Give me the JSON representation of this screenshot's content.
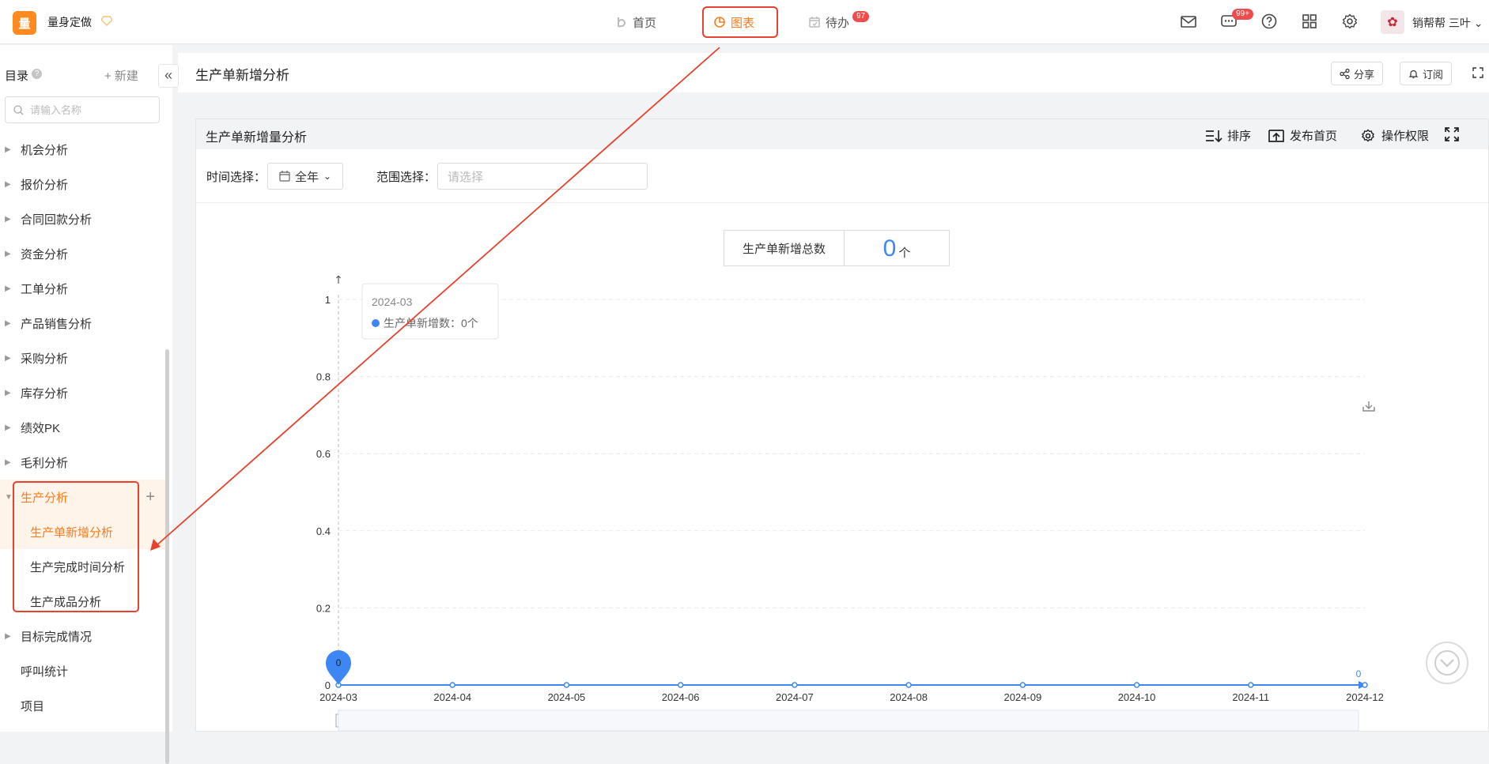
{
  "brand": {
    "logo_char": "量",
    "name": "量身定做"
  },
  "nav": {
    "home": "首页",
    "charts": "图表",
    "todo": "待办",
    "todo_badge": "97"
  },
  "topbar": {
    "message_badge": "99+",
    "username": "销帮帮 三叶"
  },
  "sidebar": {
    "title": "目录",
    "help": "?",
    "new_label": "+ 新建",
    "collapse": "«",
    "search_placeholder": "请输入名称",
    "items": [
      {
        "label": "机会分析"
      },
      {
        "label": "报价分析"
      },
      {
        "label": "合同回款分析"
      },
      {
        "label": "资金分析"
      },
      {
        "label": "工单分析"
      },
      {
        "label": "产品销售分析"
      },
      {
        "label": "采购分析"
      },
      {
        "label": "库存分析"
      },
      {
        "label": "绩效PK"
      },
      {
        "label": "毛利分析"
      }
    ],
    "group": {
      "label": "生产分析",
      "children": [
        {
          "label": "生产单新增分析"
        },
        {
          "label": "生产完成时间分析"
        },
        {
          "label": "生产成品分析"
        }
      ]
    },
    "after": [
      {
        "label": "目标完成情况"
      },
      {
        "label": "呼叫统计"
      },
      {
        "label": "项目"
      }
    ]
  },
  "header": {
    "title": "生产单新增分析",
    "share": "分享",
    "subscribe": "订阅"
  },
  "panel": {
    "title": "生产单新增量分析",
    "sort": "排序",
    "publish": "发布首页",
    "permission": "操作权限",
    "time_label": "时间选择：",
    "time_value": "全年",
    "range_label": "范围选择：",
    "range_placeholder": "请选择",
    "kpi_label": "生产单新增总数",
    "kpi_value": "0",
    "kpi_unit": "个"
  },
  "chart_data": {
    "type": "line",
    "x": [
      "2024-03",
      "2024-04",
      "2024-05",
      "2024-06",
      "2024-07",
      "2024-08",
      "2024-09",
      "2024-10",
      "2024-11",
      "2024-12"
    ],
    "series": [
      {
        "name": "生产单新增数",
        "values": [
          0,
          0,
          0,
          0,
          0,
          0,
          0,
          0,
          0,
          0
        ]
      }
    ],
    "ylim": [
      0,
      1
    ],
    "yticks": [
      "0",
      "0.2",
      "0.4",
      "0.6",
      "0.8",
      "1"
    ],
    "y_axis_arrow": "↑",
    "markers": [
      "0",
      "0"
    ],
    "tooltip": {
      "title": "2024-03",
      "text": "生产单新增数：0个"
    },
    "color": "#3d87f5",
    "grid": true
  }
}
